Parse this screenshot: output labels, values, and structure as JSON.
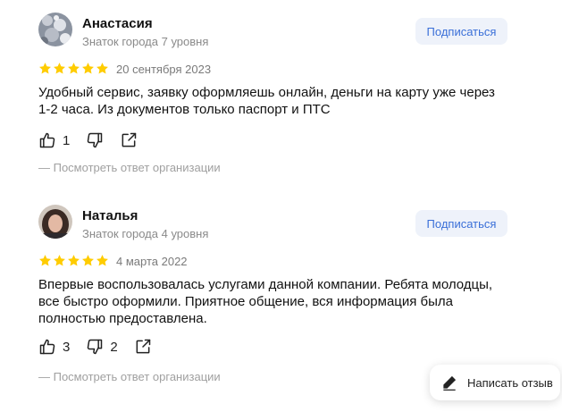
{
  "reviews": [
    {
      "name": "Анастасия",
      "level": "Знаток города 7 уровня",
      "subscribe_label": "Подписаться",
      "rating": 5,
      "date": "20 сентября 2023",
      "text": "Удобный сервис, заявку оформляешь онлайн, деньги на карту уже через 1-2 часа. Из документов только паспорт и ПТС",
      "likes": "1",
      "dislikes": "",
      "org_reply_label": "— Посмотреть ответ организации"
    },
    {
      "name": "Наталья",
      "level": "Знаток города 4 уровня",
      "subscribe_label": "Подписаться",
      "rating": 5,
      "date": "4 марта 2022",
      "text": "Впервые воспользовалась услугами данной компании. Ребята молодцы, все быстро оформили. Приятное общение, вся информация была полностью предоставлена.",
      "likes": "3",
      "dislikes": "2",
      "org_reply_label": "— Посмотреть ответ организации"
    }
  ],
  "write_review_label": "Написать отзыв",
  "colors": {
    "star": "#fc0",
    "accent": "#3a6fd8",
    "button_bg": "#eef2fa",
    "muted": "#8a8a8a"
  },
  "icons": [
    "thumb-up-icon",
    "thumb-down-icon",
    "share-icon",
    "star-icon",
    "pencil-icon"
  ]
}
